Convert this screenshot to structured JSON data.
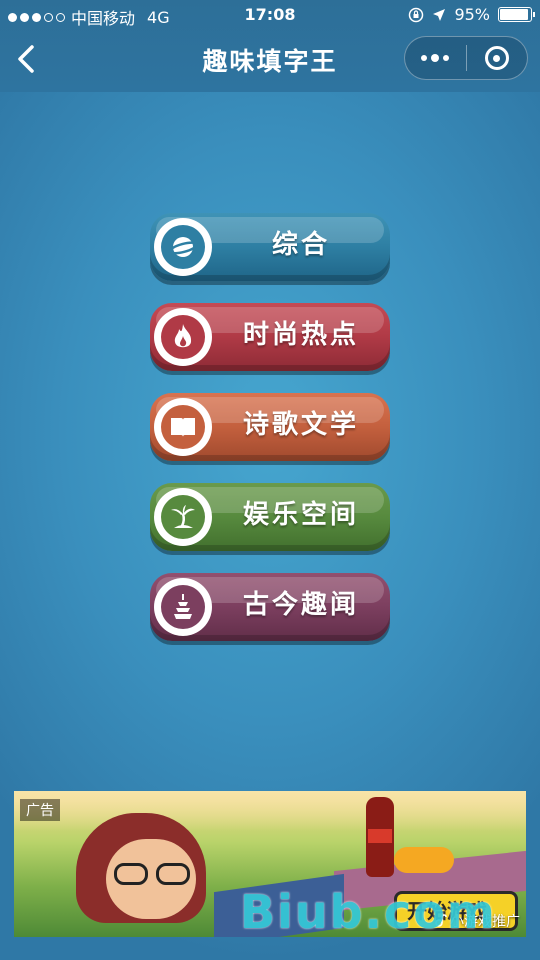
{
  "status_bar": {
    "carrier": "中国移动",
    "network": "4G",
    "time": "17:08",
    "battery": "95%",
    "battery_level": 0.95
  },
  "nav": {
    "title": "趣味填字王"
  },
  "categories": [
    {
      "label": "综合",
      "icon": "planet-icon",
      "color": "#2e7fa3"
    },
    {
      "label": "时尚热点",
      "icon": "fire-icon",
      "color": "#b03a46"
    },
    {
      "label": "诗歌文学",
      "icon": "book-icon",
      "color": "#c4603e"
    },
    {
      "label": "娱乐空间",
      "icon": "palm-island-icon",
      "color": "#578a3e"
    },
    {
      "label": "古今趣闻",
      "icon": "pagoda-icon",
      "color": "#7c3f5f"
    }
  ],
  "ad": {
    "tag": "广告",
    "button": "开始游戏",
    "promo": "小游戏推广"
  },
  "watermark": "Biub.com"
}
